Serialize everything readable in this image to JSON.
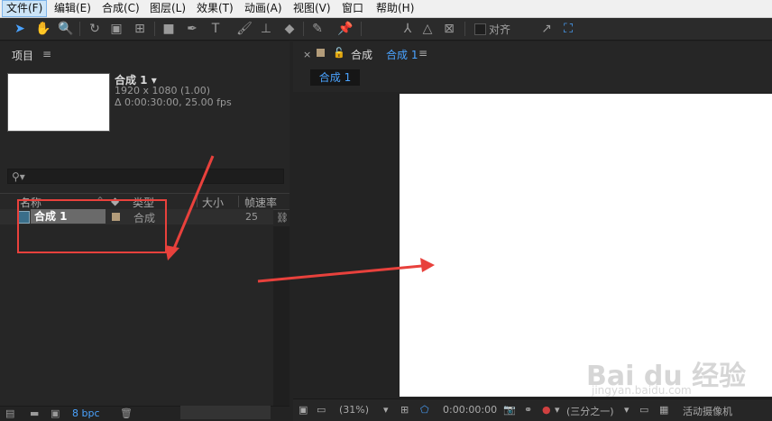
{
  "menu": [
    "文件(F)",
    "编辑(E)",
    "合成(C)",
    "图层(L)",
    "效果(T)",
    "动画(A)",
    "视图(V)",
    "窗口",
    "帮助(H)"
  ],
  "toolbar": {
    "tools": [
      "selection-icon",
      "hand-icon",
      "zoom-icon",
      "rotate-icon",
      "camera-icon",
      "pan-behind-icon",
      "rectangle-icon",
      "pen-icon",
      "type-icon",
      "brush-icon",
      "clone-stamp-icon",
      "eraser-icon",
      "roto-brush-icon",
      "puppet-pin-icon",
      "axis-local-icon",
      "axis-world-icon",
      "axis-view-icon",
      "expand-icon",
      "snap-icon"
    ],
    "snap_label": "对齐"
  },
  "project": {
    "tab_label": "项目",
    "menu_glyph": "≡",
    "comp_name": "合成 1 ▾",
    "comp_resolution": "1920 x 1080 (1.00)",
    "comp_duration": "Δ 0:00:30:00, 25.00 fps",
    "search_glyph": "⚲▾",
    "columns": [
      "名称",
      "类型",
      "大小",
      "帧速率"
    ],
    "row": {
      "name": "合成 1",
      "type": "合成",
      "fps": "25"
    },
    "bpc": "8 bpc"
  },
  "composition": {
    "close": "×",
    "tab_word": "合成",
    "tab_name": "合成 1",
    "menu_glyph": "≡",
    "breadcrumb": "合成 1",
    "zoom": "(31%)",
    "timecode": "0:00:00:00",
    "resolution": "(三分之一)",
    "camera": "活动摄像机"
  },
  "watermark": {
    "main": "Bai du 经验",
    "sub": "jingyan.baidu.com"
  },
  "colors": {
    "accent": "#4aa3ff",
    "annotation": "#e8413c",
    "label": "#b39c7a"
  }
}
